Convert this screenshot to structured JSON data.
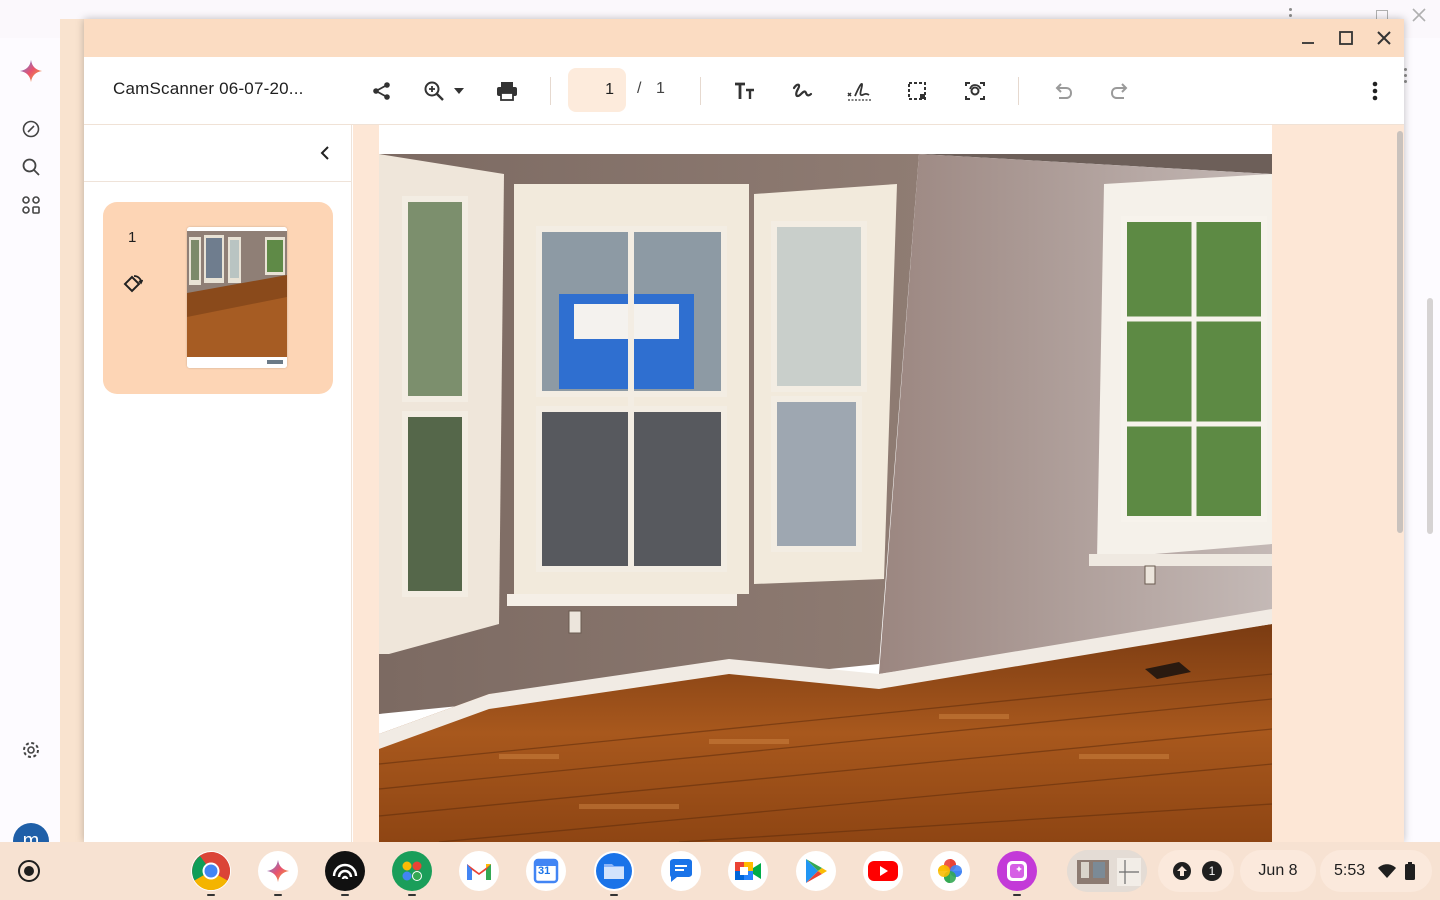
{
  "viewer": {
    "doc_title": "CamScanner 06-07-20...",
    "current_page": "1",
    "page_sep": "/",
    "total_pages": "1",
    "thumbnail_page_number": "1"
  },
  "colors": {
    "titlebar": "#fbdcc2",
    "accent_card": "#fdd5b5",
    "viewport_bg": "#fde7d6",
    "shelf_bg": "#f7e2d2"
  },
  "toolbar_icons": [
    "share-icon",
    "zoom-in-icon",
    "zoom-dropdown-icon",
    "print-icon",
    "text-icon",
    "draw-icon",
    "signature-icon",
    "select-area-icon",
    "screenshot-search-icon",
    "undo-icon",
    "redo-icon",
    "more-options-icon"
  ],
  "profile": {
    "initial": "m"
  },
  "shelf": {
    "apps": [
      "Chrome",
      "Gemini",
      "Audible",
      "Google",
      "Gmail",
      "Calendar",
      "Files",
      "Messages",
      "Meet",
      "Play Store",
      "YouTube",
      "Photos",
      "Gallery"
    ],
    "calendar_day": "31",
    "notification_count": "1",
    "date": "Jun 8",
    "time": "5:53"
  }
}
